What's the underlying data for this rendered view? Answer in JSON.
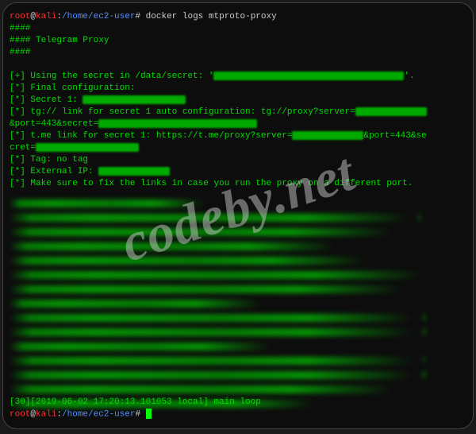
{
  "prompt1": {
    "user": "root",
    "at": "@",
    "host": "kali",
    "colon": ":",
    "path": "/home/ec2-user",
    "hash": "#",
    "command": "docker logs mtproto-proxy"
  },
  "output": {
    "l1": "####",
    "l2": "#### Telegram Proxy",
    "l3": "####",
    "l4": "[+] Using the secret in /data/secret: '",
    "l4b": "'.",
    "l5": "[*] Final configuration:",
    "l6": "[*]   Secret 1: ",
    "l7": "[*]   tg:// link for secret 1 auto configuration: tg://proxy?server=",
    "l8": "&port=443&secret=",
    "l9": "[*]   t.me link for secret 1: https://t.me/proxy?server=",
    "l9b": "&port=443&se",
    "l10": "cret=",
    "l11": "[*]   Tag: no tag",
    "l12": "[*]   External IP: ",
    "l13": "[*]   Make sure to fix the links in case you run the proxy on a different port.",
    "bottom_log": "[30][2019-06-02 17:20:13.101053 local] main loop"
  },
  "nums": {
    "n1": "1",
    "n4": "4",
    "n4b": "4",
    "n7": "7",
    "n8": "8"
  },
  "prompt2": {
    "user": "root",
    "at": "@",
    "host": "kali",
    "colon": ":",
    "path": "/home/ec2-user",
    "hash": "#"
  },
  "watermark": "codeby.net"
}
